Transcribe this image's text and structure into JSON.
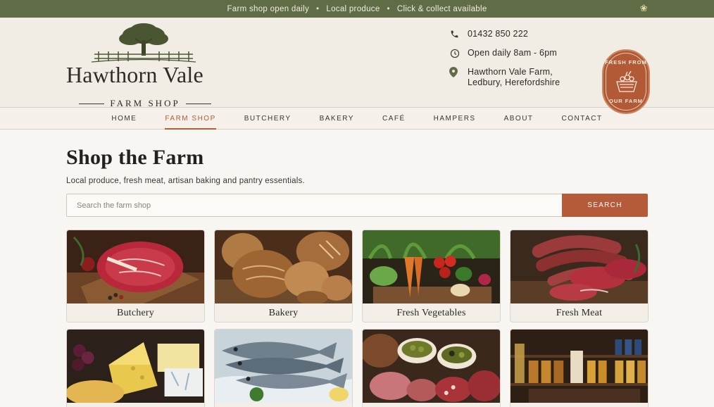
{
  "topbar": {
    "items": [
      "Farm shop open daily",
      "Local produce",
      "Click & collect available"
    ],
    "separator": "•"
  },
  "logo": {
    "name": "Hawthorn Vale",
    "sub": "FARM SHOP"
  },
  "contact": {
    "phone": "01432 850 222",
    "hours": "Open daily 8am - 6pm",
    "address_line1": "Hawthorn Vale Farm,",
    "address_line2": "Ledbury, Herefordshire"
  },
  "badge": {
    "top": "FRESH FROM",
    "bottom": "OUR FARM"
  },
  "nav": {
    "items": [
      "HOME",
      "FARM SHOP",
      "BUTCHERY",
      "BAKERY",
      "CAFÉ",
      "HAMPERS",
      "ABOUT",
      "CONTACT"
    ],
    "active": "FARM SHOP"
  },
  "main": {
    "title": "Shop the Farm",
    "lead": "Local produce, fresh meat, artisan baking and pantry essentials.",
    "search_placeholder": "Search the farm shop",
    "search_button": "SEARCH"
  },
  "categories": [
    {
      "label": "Butchery",
      "icon": "steak-image"
    },
    {
      "label": "Bakery",
      "icon": "bread-image"
    },
    {
      "label": "Fresh Vegetables",
      "icon": "vegetables-image"
    },
    {
      "label": "Fresh Meat",
      "icon": "sausages-image"
    },
    {
      "label": "",
      "icon": "cheese-image"
    },
    {
      "label": "",
      "icon": "fish-image"
    },
    {
      "label": "",
      "icon": "deli-image"
    },
    {
      "label": "",
      "icon": "pantry-image"
    }
  ],
  "colors": {
    "topbar": "#5f6c45",
    "accent": "#b55b39",
    "header_bg": "#f1ece4",
    "page_bg": "#f8f6f2"
  }
}
